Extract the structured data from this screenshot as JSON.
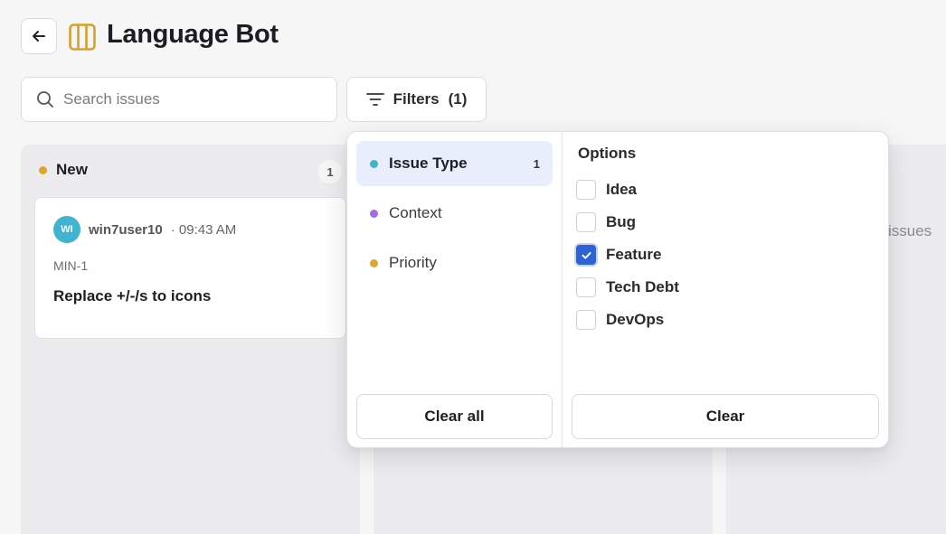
{
  "header": {
    "title": "Language Bot",
    "back_icon": "arrow-left-icon",
    "board_icon": "columns-icon",
    "board_icon_color": "#d4a22c"
  },
  "search": {
    "placeholder": "Search issues",
    "value": ""
  },
  "filters_button": {
    "label": "Filters",
    "count": "(1)"
  },
  "columns": [
    {
      "title": "New",
      "count": "1",
      "dot_color": "#e0a62b",
      "cards": [
        {
          "avatar_initials": "WI",
          "avatar_color": "#3fb3cf",
          "user": "win7user10",
          "time": "· 09:43 AM",
          "id": "MIN-1",
          "title": "Replace +/-/s to icons"
        }
      ]
    },
    {
      "title": "",
      "count": "",
      "cards": []
    },
    {
      "title": "",
      "empty_text": "issues",
      "cards": []
    }
  ],
  "filter_panel": {
    "categories": [
      {
        "label": "Issue Type",
        "count": "1",
        "dot_color": "#3fb3cf",
        "active": true
      },
      {
        "label": "Context",
        "count": "",
        "dot_color": "#a46be3",
        "active": false
      },
      {
        "label": "Priority",
        "count": "",
        "dot_color": "#e0a62b",
        "active": false
      }
    ],
    "clear_all_label": "Clear all",
    "options_label": "Options",
    "options": [
      {
        "label": "Idea",
        "checked": false
      },
      {
        "label": "Bug",
        "checked": false
      },
      {
        "label": "Feature",
        "checked": true
      },
      {
        "label": "Tech Debt",
        "checked": false
      },
      {
        "label": "DevOps",
        "checked": false
      }
    ],
    "clear_label": "Clear",
    "accent_color": "#2e63d6"
  }
}
